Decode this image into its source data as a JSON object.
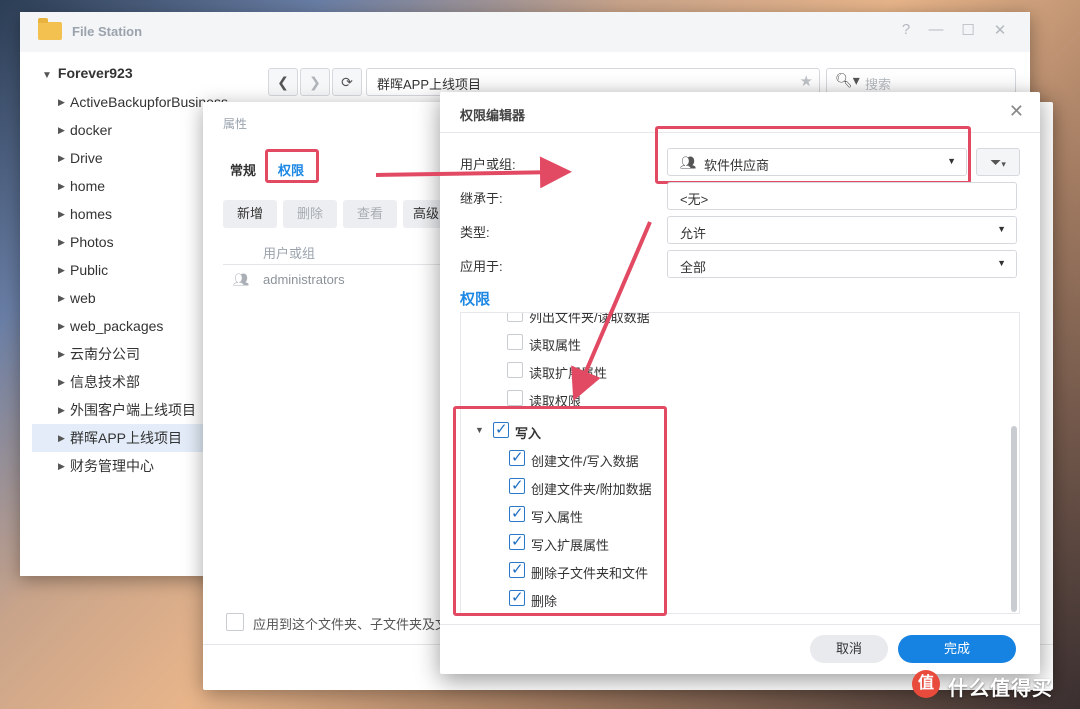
{
  "file_station": {
    "title": "File Station",
    "controls": [
      "?",
      "—",
      "☐",
      "✕"
    ],
    "tree": {
      "root": "Forever923",
      "items": [
        "ActiveBackupforBusiness",
        "docker",
        "Drive",
        "home",
        "homes",
        "Photos",
        "Public",
        "web",
        "web_packages",
        "云南分公司",
        "信息技术部",
        "外围客户端上线项目",
        "群晖APP上线项目",
        "财务管理中心"
      ],
      "selected": "群晖APP上线项目"
    },
    "path": "群晖APP上线项目",
    "search_placeholder": "搜索"
  },
  "properties": {
    "title": "属性",
    "tabs": [
      "常规",
      "权限"
    ],
    "active_tab": "权限",
    "toolbar": [
      "新增",
      "删除",
      "查看",
      "高级"
    ],
    "table_header": "用户或组",
    "rows": [
      "administrators"
    ],
    "apply_label": "应用到这个文件夹、子文件夹及文"
  },
  "permission_editor": {
    "title": "权限编辑器",
    "user_label": "用户或组:",
    "user_value": "软件供应商",
    "inherit_label": "继承于:",
    "inherit_value": "<无>",
    "type_label": "类型:",
    "type_value": "允许",
    "apply_label": "应用于:",
    "apply_value": "全部",
    "section_title": "权限",
    "read_items": [
      {
        "label": "列出文件夹/读取数据",
        "checked": false
      },
      {
        "label": "读取属性",
        "checked": false
      },
      {
        "label": "读取扩展属性",
        "checked": false
      },
      {
        "label": "读取权限",
        "checked": false
      }
    ],
    "write_group": {
      "label": "写入",
      "checked": true
    },
    "write_items": [
      {
        "label": "创建文件/写入数据",
        "checked": true
      },
      {
        "label": "创建文件夹/附加数据",
        "checked": true
      },
      {
        "label": "写入属性",
        "checked": true
      },
      {
        "label": "写入扩展属性",
        "checked": true
      },
      {
        "label": "删除子文件夹和文件",
        "checked": true
      },
      {
        "label": "删除",
        "checked": true
      }
    ],
    "cancel": "取消",
    "done": "完成"
  },
  "watermark": "什么值得买",
  "colors": {
    "accent": "#1e88e5",
    "highlight_box": "#e24a64",
    "primary_button": "#1683e2"
  }
}
